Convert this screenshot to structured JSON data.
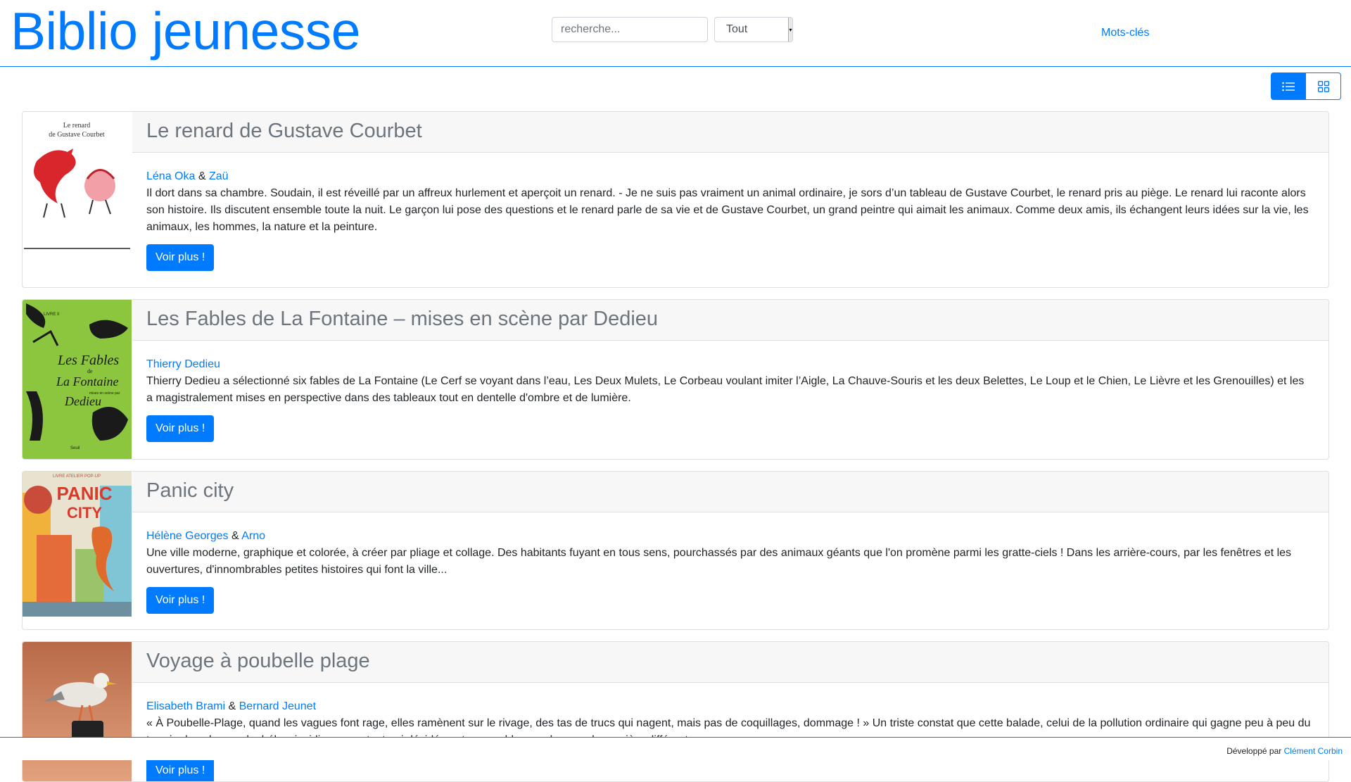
{
  "header": {
    "title": "Biblio jeunesse",
    "search_placeholder": "recherche...",
    "filter_selected": "Tout",
    "nav_keywords": "Mots-clés"
  },
  "view_toggle": {
    "active": "list",
    "icons": [
      "list-icon",
      "grid-icon"
    ]
  },
  "books": [
    {
      "title": "Le renard de Gustave Courbet",
      "authors": [
        "Léna Oka",
        "Zaü"
      ],
      "separator": "&",
      "description": "Il dort dans sa chambre. Soudain, il est réveillé par un affreux hurlement et aperçoit un renard. - Je ne suis pas vraiment un animal ordinaire, je sors d’un tableau de Gustave Courbet, le renard pris au piège. Le renard lui raconte alors son histoire. Ils discutent ensemble toute la nuit. Le garçon lui pose des questions et le renard parle de sa vie et de Gustave Courbet, un grand peintre qui aimait les animaux. Comme deux amis, ils échangent leurs idées sur la vie, les animaux, les hommes, la nature et la peinture.",
      "button": "Voir plus !",
      "cover_text": [
        "Le renard",
        "de Gustave Courbet"
      ]
    },
    {
      "title": "Les Fables de La Fontaine – mises en scène par Dedieu",
      "authors": [
        "Thierry Dedieu"
      ],
      "separator": "",
      "description": "Thierry Dedieu a sélectionné six fables de La Fontaine (Le Cerf se voyant dans l’eau, Les Deux Mulets, Le Corbeau voulant imiter l’Aigle, La Chauve-Souris et les deux Belettes, Le Loup et le Chien, Le Lièvre et les Grenouilles) et les a magistralement mises en perspective dans des tableaux tout en dentelle d'ombre et de lumière.",
      "button": "Voir plus !",
      "cover_text": [
        "LIVRE II",
        "Les Fables",
        "de",
        "La Fontaine",
        "mises en scène par",
        "Dedieu",
        "Seuil"
      ]
    },
    {
      "title": "Panic city",
      "authors": [
        "Hélène Georges",
        "Arno"
      ],
      "separator": "&",
      "description": "Une ville moderne, graphique et colorée, à créer par pliage et collage. Des habitants fuyant en tous sens, pourchassés par des animaux géants que l'on promène parmi les gratte-ciels ! Dans les arrière-cours, par les fenêtres et les ouvertures, d'innombrables petites histoires qui font la ville...",
      "button": "Voir plus !",
      "cover_text": [
        "LIVRE ATELIER POP-UP",
        "PANIC",
        "CITY"
      ]
    },
    {
      "title": "Voyage à poubelle plage",
      "authors": [
        "Elisabeth Brami",
        "Bernard Jeunet"
      ],
      "separator": "&",
      "description": "« À Poubelle-Plage, quand les vagues font rage, elles ramènent sur le rivage, des tas de trucs qui nagent, mais pas de coquillages, dommage ! » Un triste constat que cette balade, celui de la pollution ordinaire qui gagne peu à peu du terrain dans le monde, hélas, insidieusement, et qui décidément ne semble pas changer de manière différente.",
      "button": "Voir plus !",
      "cover_text": []
    }
  ],
  "footer": {
    "prefix": "Développé par",
    "developer": "Clément Corbin"
  },
  "colors": {
    "primary": "#007bff",
    "card_header_bg": "#f7f7f7",
    "border": "#dfdfdf"
  }
}
